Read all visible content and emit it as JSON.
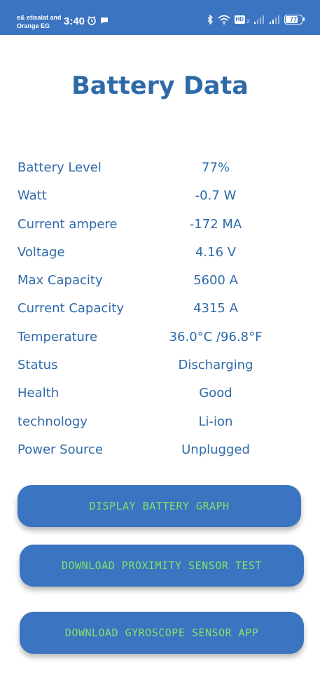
{
  "status_bar": {
    "carrier_line1": "e& etisalat and",
    "carrier_line2": "Orange EG",
    "time": "3:40",
    "icons": [
      "alarm-icon",
      "chat-icon",
      "bluetooth-icon",
      "wifi-icon",
      "hd-icon",
      "signal-icon",
      "signal-icon-2"
    ],
    "hd_label": "HD",
    "hd_sub": "2",
    "battery_percent": "77",
    "battery_level": 0.77
  },
  "title": "Battery Data",
  "rows": [
    {
      "label": "Battery Level",
      "value": "77%"
    },
    {
      "label": "Watt",
      "value": "-0.7 W"
    },
    {
      "label": "Current ampere",
      "value": "-172 MA"
    },
    {
      "label": "Voltage",
      "value": "4.16 V"
    },
    {
      "label": "Max Capacity",
      "value": "5600 A"
    },
    {
      "label": "Current Capacity",
      "value": "4315 A"
    },
    {
      "label": "Temperature",
      "value": "36.0°C /96.8°F"
    },
    {
      "label": "Status",
      "value": "Discharging"
    },
    {
      "label": "Health",
      "value": "Good"
    },
    {
      "label": "technology",
      "value": "Li-ion"
    },
    {
      "label": "Power Source",
      "value": "Unplugged"
    }
  ],
  "buttons": {
    "graph": "DISPLAY BATTERY GRAPH",
    "proximity": "DOWNLOAD PROXIMITY SENSOR TEST",
    "gyroscope": "DOWNLOAD GYROSCOPE SENSOR APP"
  },
  "colors": {
    "accent": "#3b74c0",
    "text": "#2f6aa8",
    "button_text": "#7ee36b"
  }
}
